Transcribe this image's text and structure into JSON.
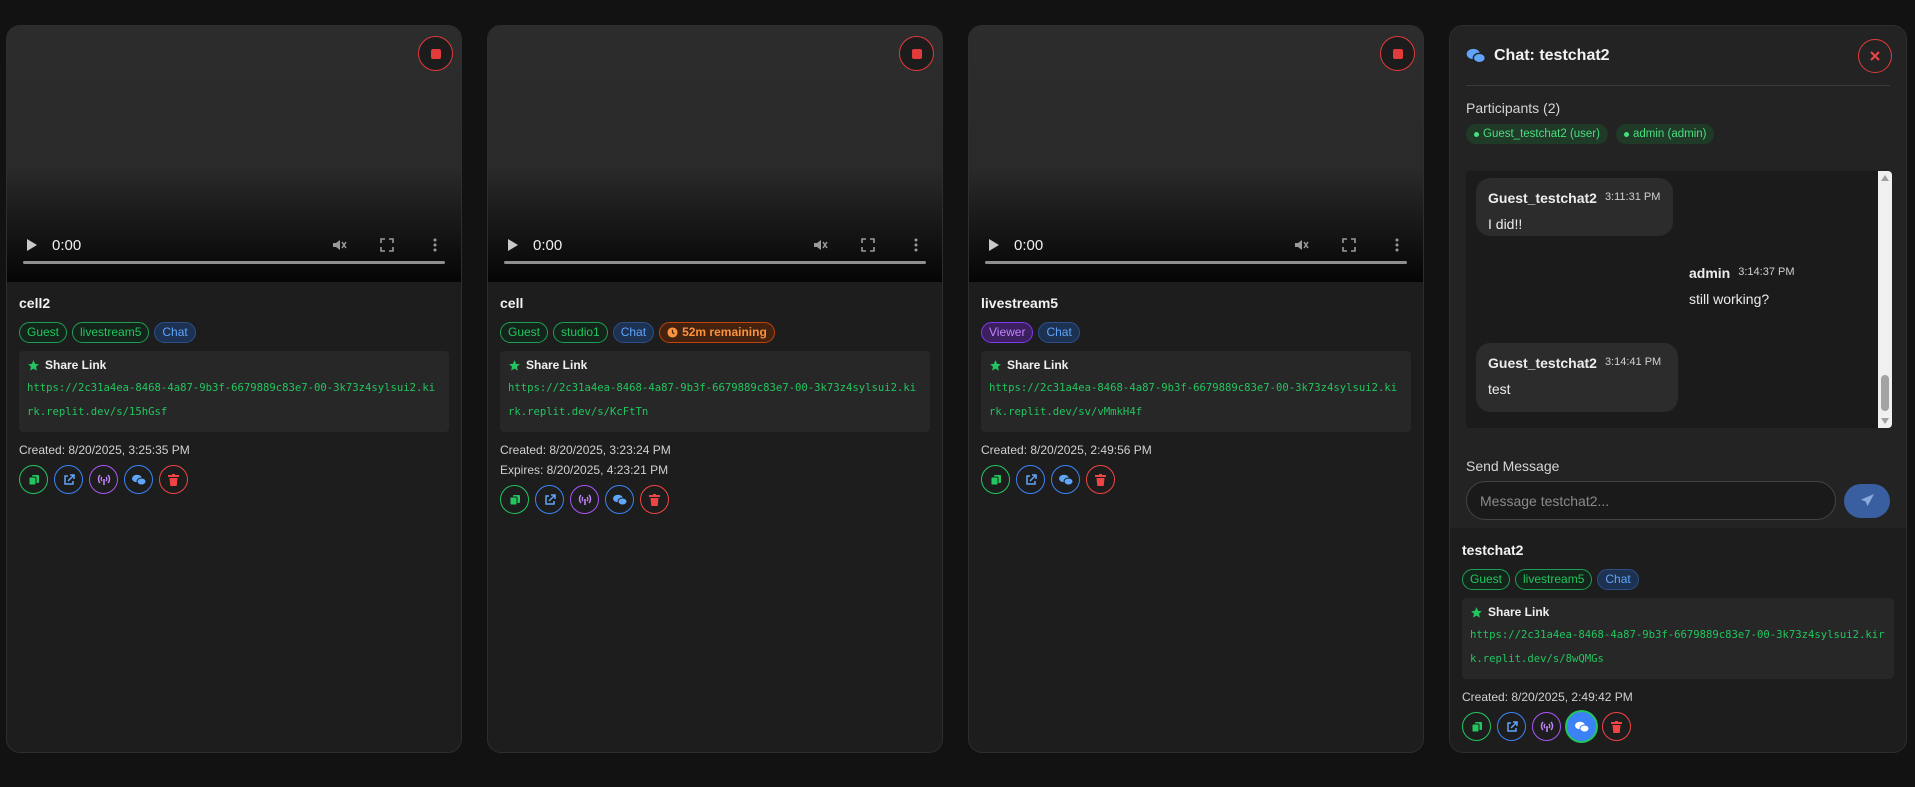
{
  "cards": [
    {
      "video": {
        "time": "0:00"
      },
      "name": "cell2",
      "badges": [
        "Guest",
        "livestream5",
        "Chat"
      ],
      "share_label": "Share Link",
      "share_url": "https://2c31a4ea-8468-4a87-9b3f-6679889c83e7-00-3k73z4sylsui2.kirk.replit.dev/s/15hGsf",
      "created": "Created: 8/20/2025, 3:25:35 PM"
    },
    {
      "video": {
        "time": "0:00"
      },
      "name": "cell",
      "badges": [
        "Guest",
        "studio1",
        "Chat"
      ],
      "remaining": "52m remaining",
      "share_label": "Share Link",
      "share_url": "https://2c31a4ea-8468-4a87-9b3f-6679889c83e7-00-3k73z4sylsui2.kirk.replit.dev/s/KcFtTn",
      "created": "Created: 8/20/2025, 3:23:24 PM",
      "expires": "Expires: 8/20/2025, 4:23:21 PM"
    },
    {
      "video": {
        "time": "0:00"
      },
      "name": "livestream5",
      "badges": [
        "Viewer",
        "Chat"
      ],
      "share_label": "Share Link",
      "share_url": "https://2c31a4ea-8468-4a87-9b3f-6679889c83e7-00-3k73z4sylsui2.kirk.replit.dev/sv/vMmkH4f",
      "created": "Created: 8/20/2025, 2:49:56 PM"
    },
    {
      "name": "testchat2",
      "badges": [
        "Guest",
        "livestream5",
        "Chat"
      ],
      "share_label": "Share Link",
      "share_url": "https://2c31a4ea-8468-4a87-9b3f-6679889c83e7-00-3k73z4sylsui2.kirk.replit.dev/s/8wQMGs",
      "created": "Created: 8/20/2025, 2:49:42 PM"
    }
  ],
  "chat": {
    "title": "Chat: testchat2",
    "participants_label": "Participants (2)",
    "participants": [
      "Guest_testchat2 (user)",
      "admin (admin)"
    ],
    "messages": [
      {
        "sender": "Guest_testchat2",
        "time": "3:11:31 PM",
        "text": "I did!!"
      },
      {
        "sender": "admin",
        "time": "3:14:37 PM",
        "text": "still working?"
      },
      {
        "sender": "Guest_testchat2",
        "time": "3:14:41 PM",
        "text": "test"
      }
    ],
    "send_label": "Send Message",
    "input_placeholder": "Message testchat2..."
  },
  "colors": {
    "background": "#121212",
    "card": "#1d1d1d",
    "accent_green": "#22c55e",
    "accent_blue": "#3b82f6",
    "accent_purple": "#a855f7",
    "danger_red": "#ef4444",
    "warning_orange": "#fb923c"
  },
  "icons": {
    "stop": "stop-icon",
    "play": "play-icon",
    "mute": "volume-muted-icon",
    "fullscreen": "fullscreen-icon",
    "more": "more-vertical-icon",
    "star": "star-icon",
    "copy": "copy-icon",
    "open": "external-link-icon",
    "broadcast": "broadcast-icon",
    "chat": "chat-bubbles-icon",
    "delete": "trash-icon",
    "clock": "clock-icon",
    "close": "close-icon",
    "send": "send-icon"
  }
}
